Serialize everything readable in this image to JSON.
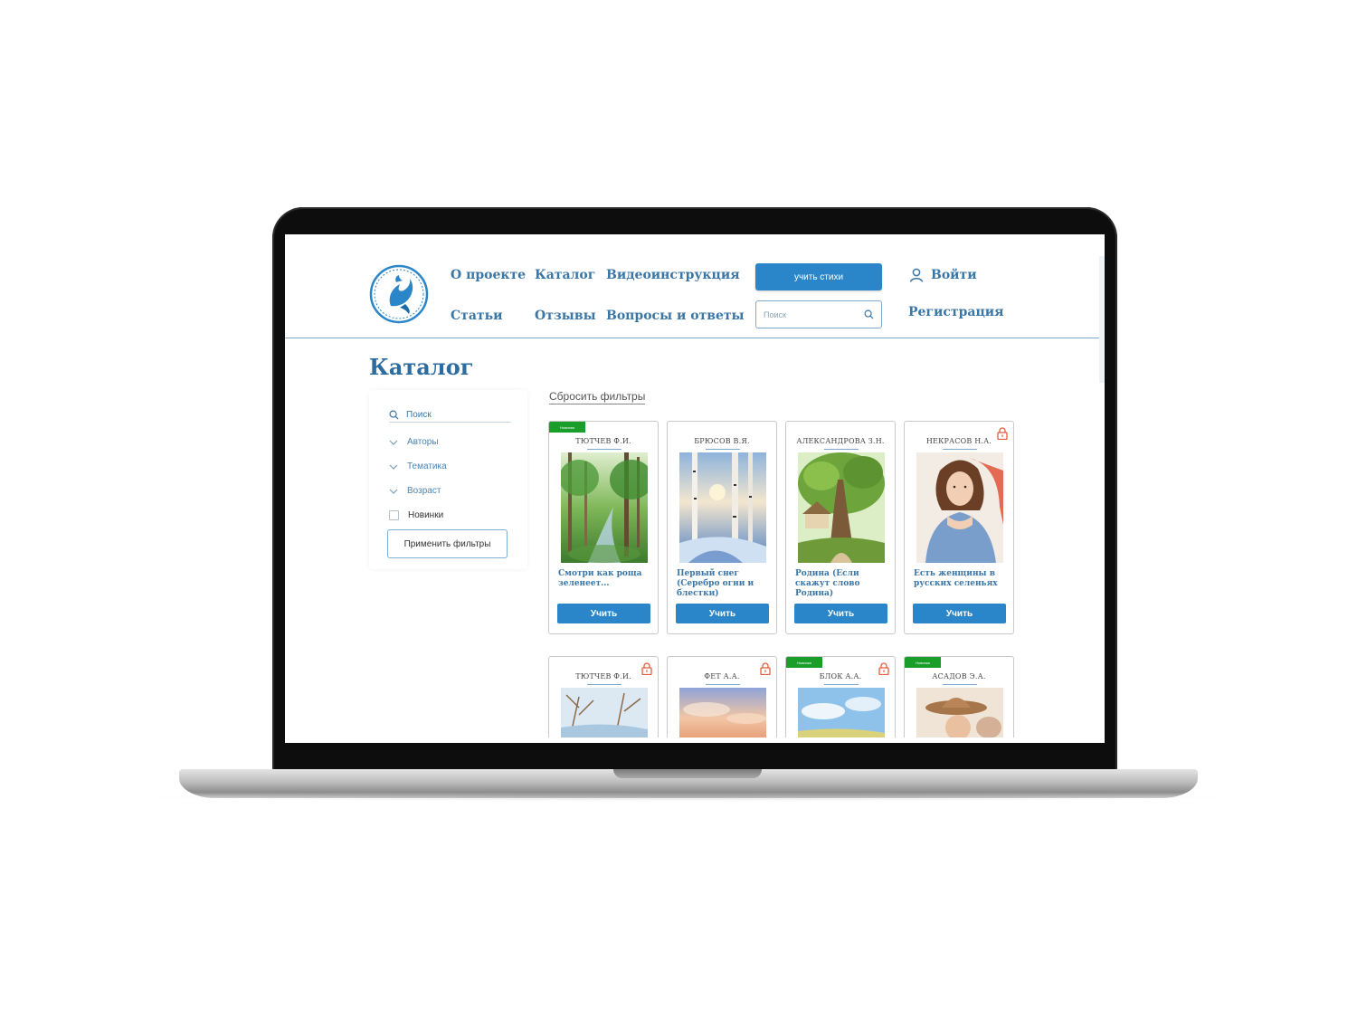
{
  "nav": {
    "about": "О проекте",
    "catalog": "Каталог",
    "video": "Видеоинструкция",
    "articles": "Статьи",
    "reviews": "Отзывы",
    "faq": "Вопросы и ответы"
  },
  "header": {
    "learn_button": "учить стихи",
    "search_placeholder": "Поиск",
    "login": "Войти",
    "register": "Регистрация"
  },
  "page": {
    "title": "Каталог"
  },
  "filters": {
    "search": "Поиск",
    "authors": "Авторы",
    "topics": "Тематика",
    "age": "Возраст",
    "new_only": "Новинки",
    "apply": "Применить фильтры",
    "reset": "Сбросить фильтры"
  },
  "badge_new": "Новинки",
  "study_label": "Учить",
  "cards_row1": [
    {
      "author": "ТЮТЧЕВ Ф.И.",
      "title": "Смотри как роща зеленеет...",
      "is_new": true,
      "locked": false,
      "cover": "forest"
    },
    {
      "author": "БРЮСОВ В.Я.",
      "title": "Первый снег (Серебро огни и блестки)",
      "is_new": false,
      "locked": false,
      "cover": "winter"
    },
    {
      "author": "АЛЕКСАНДРОВА З.Н.",
      "title": "Родина (Если скажут слово Родина)",
      "is_new": false,
      "locked": false,
      "cover": "village"
    },
    {
      "author": "НЕКРАСОВ Н.А.",
      "title": "Есть женщины в русских селеньях",
      "is_new": false,
      "locked": true,
      "cover": "woman"
    }
  ],
  "cards_row2": [
    {
      "author": "ТЮТЧЕВ Ф.И.",
      "is_new": false,
      "locked": true,
      "cover": "spring"
    },
    {
      "author": "ФЕТ А.А.",
      "is_new": false,
      "locked": true,
      "cover": "sunset"
    },
    {
      "author": "БЛОК А.А.",
      "is_new": true,
      "locked": true,
      "cover": "sky"
    },
    {
      "author": "АСАДОВ Э.А.",
      "is_new": true,
      "locked": false,
      "cover": "hat"
    }
  ],
  "colors": {
    "primary": "#2a86c8",
    "link": "#3a76a6",
    "badge": "#1a9e2a",
    "lock": "#e25c3a"
  }
}
